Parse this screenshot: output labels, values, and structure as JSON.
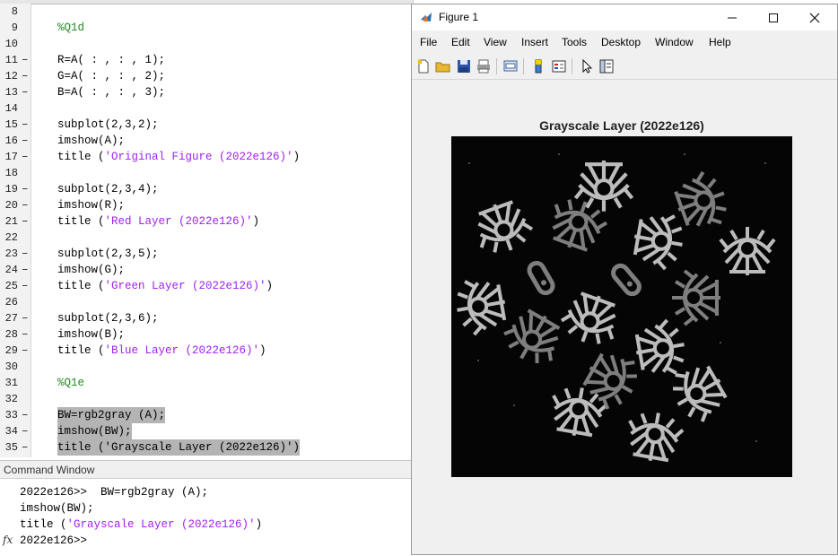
{
  "editor": {
    "lines": [
      {
        "n": "8",
        "dash": "",
        "code": ""
      },
      {
        "n": "9",
        "dash": "",
        "code": "%Q1d",
        "type": "comment"
      },
      {
        "n": "10",
        "dash": "",
        "code": ""
      },
      {
        "n": "11",
        "dash": "–",
        "code": "R=A( : , : , 1);"
      },
      {
        "n": "12",
        "dash": "–",
        "code": "G=A( : , : , 2);"
      },
      {
        "n": "13",
        "dash": "–",
        "code": "B=A( : , : , 3);"
      },
      {
        "n": "14",
        "dash": "",
        "code": ""
      },
      {
        "n": "15",
        "dash": "–",
        "code": "subplot(2,3,2);"
      },
      {
        "n": "16",
        "dash": "–",
        "code": "imshow(A);"
      },
      {
        "n": "17",
        "dash": "–",
        "code": "title (",
        "str": "'Original Figure (2022e126)'",
        "tail": ")"
      },
      {
        "n": "18",
        "dash": "",
        "code": ""
      },
      {
        "n": "19",
        "dash": "–",
        "code": "subplot(2,3,4);"
      },
      {
        "n": "20",
        "dash": "–",
        "code": "imshow(R);"
      },
      {
        "n": "21",
        "dash": "–",
        "code": "title (",
        "str": "'Red Layer (2022e126)'",
        "tail": ")"
      },
      {
        "n": "22",
        "dash": "",
        "code": ""
      },
      {
        "n": "23",
        "dash": "–",
        "code": "subplot(2,3,5);"
      },
      {
        "n": "24",
        "dash": "–",
        "code": "imshow(G);"
      },
      {
        "n": "25",
        "dash": "–",
        "code": "title (",
        "str": "'Green Layer (2022e126)'",
        "tail": ")"
      },
      {
        "n": "26",
        "dash": "",
        "code": ""
      },
      {
        "n": "27",
        "dash": "–",
        "code": "subplot(2,3,6);"
      },
      {
        "n": "28",
        "dash": "–",
        "code": "imshow(B);"
      },
      {
        "n": "29",
        "dash": "–",
        "code": "title (",
        "str": "'Blue Layer (2022e126)'",
        "tail": ")"
      },
      {
        "n": "30",
        "dash": "",
        "code": ""
      },
      {
        "n": "31",
        "dash": "",
        "code": "%Q1e",
        "type": "comment"
      },
      {
        "n": "32",
        "dash": "",
        "code": ""
      },
      {
        "n": "33",
        "dash": "–",
        "code": "BW=rgb2gray (A);",
        "hl": true
      },
      {
        "n": "34",
        "dash": "–",
        "code": "imshow(BW);",
        "hl": true
      },
      {
        "n": "35",
        "dash": "–",
        "code": "title ('Grayscale Layer (2022e126)')",
        "hl": true
      }
    ]
  },
  "command_window": {
    "title": "Command Window",
    "line1": "2022e126>>  BW=rgb2gray (A);",
    "line2": "imshow(BW);",
    "line3_pre": "title (",
    "line3_str": "'Grayscale Layer (2022e126)'",
    "line3_post": ")",
    "prompt": "2022e126>>",
    "fx": "fx"
  },
  "figure": {
    "window_title": "Figure 1",
    "menus": [
      "File",
      "Edit",
      "View",
      "Insert",
      "Tools",
      "Desktop",
      "Window",
      "Help"
    ],
    "axes_title": "Grayscale Layer (2022e126)"
  },
  "colors": {
    "string": "#a020f0",
    "comment": "#228b22",
    "highlight": "#b4b4b4"
  }
}
